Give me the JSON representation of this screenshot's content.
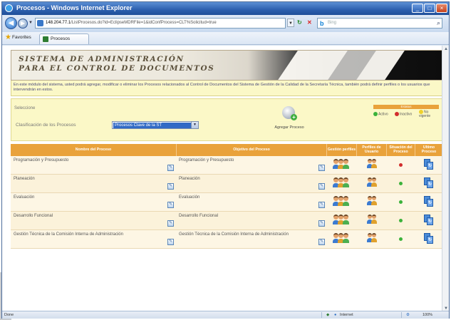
{
  "window": {
    "title": "Procesos - Windows Internet Explorer",
    "controls": {
      "minimize": "_",
      "maximize": "□",
      "close": "×"
    }
  },
  "address_bar": {
    "url_host": "148.204.77.1",
    "url_rest": "/ListProcesos.do?id=EclipseMDRFile=1&idConfProcess=CLT%Solicitud=true",
    "search_engine": "Bing"
  },
  "favorites": {
    "label": "Favorites",
    "tab_label": "Procesos"
  },
  "banner": {
    "line1": "SISTEMA DE ADMINISTRACIÓN",
    "line2": "PARA EL CONTROL DE DOCUMENTOS"
  },
  "intro_text": "En este módulo del sistema, usted podrá agregar, modificar o eliminar los Procesos relacionados al Control de Documentos del Sistema de Gestión de la Calidad de la Secretaría Técnica, también podrá definir perfiles o los usuarios que intervendrán en estos.",
  "controls": {
    "select_label": "Seleccione",
    "clasificacion_label": "Clasificación de los Procesos",
    "selected_option": "Procesos Clave de la ST",
    "add_button_label": "Agregar Proceso"
  },
  "status_legend": {
    "title": "Estatus",
    "items": [
      {
        "label": "Activo",
        "color": "#3bb23b"
      },
      {
        "label": "Inactivo",
        "color": "#d12d2d"
      },
      {
        "label": "No vigente",
        "color": "#efd12c"
      }
    ]
  },
  "table": {
    "headers": [
      "Nombre del Proceso",
      "Objetivo del Proceso",
      "Gestión perfiles",
      "Perfiles de Usuario",
      "Situación del Proceso",
      "Ultimo Proceso"
    ],
    "rows": [
      {
        "nombre": "Programación y Presupuesto",
        "objetivo": "Programación y Presupuesto",
        "status_color": "#d12d2d"
      },
      {
        "nombre": "Planeación",
        "objetivo": "Planeación",
        "status_color": "#3bb23b"
      },
      {
        "nombre": "Evaluación",
        "objetivo": "Evaluación",
        "status_color": "#3bb23b"
      },
      {
        "nombre": "Desarrollo Funcional",
        "objetivo": "Desarrollo Funcional",
        "status_color": "#3bb23b"
      },
      {
        "nombre": "Gestión Técnica de la Comisión Interna de Administración",
        "objetivo": "Gestión Técnica de la Comisión Interna de Administración",
        "status_color": "#3bb23b"
      }
    ]
  },
  "status_bar": {
    "left": "Done",
    "zone": "Internet",
    "zoom": "100%"
  },
  "icons": {
    "edit": "edit-icon",
    "profiles": "user-group-icon",
    "users": "users-icon",
    "status": "status-dot-icon",
    "process": "document-icon"
  }
}
